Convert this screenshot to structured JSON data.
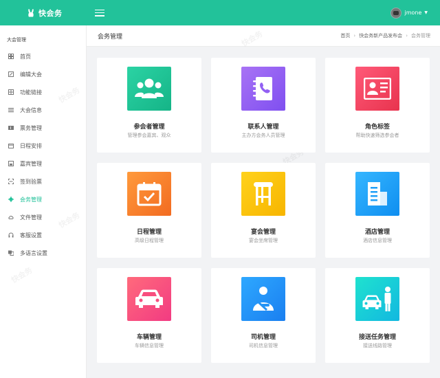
{
  "app": {
    "brand_name": "快会务"
  },
  "user": {
    "name": "jmone"
  },
  "sidebar": {
    "title": "大会管理",
    "items": [
      {
        "label": "首页",
        "icon": "home-icon"
      },
      {
        "label": "编辑大会",
        "icon": "edit-icon"
      },
      {
        "label": "功能链接",
        "icon": "link-icon"
      },
      {
        "label": "大会信息",
        "icon": "list-icon"
      },
      {
        "label": "票务管理",
        "icon": "ticket-icon"
      },
      {
        "label": "日程安排",
        "icon": "calendar-icon"
      },
      {
        "label": "嘉宾管理",
        "icon": "guest-icon"
      },
      {
        "label": "签到验票",
        "icon": "scan-icon"
      },
      {
        "label": "会务管理",
        "icon": "gear-icon",
        "active": true
      },
      {
        "label": "文件管理",
        "icon": "cloud-icon"
      },
      {
        "label": "客服设置",
        "icon": "headset-icon"
      },
      {
        "label": "多语言设置",
        "icon": "language-icon"
      }
    ]
  },
  "header": {
    "title": "会务管理",
    "breadcrumb": [
      "首页",
      "快会务新产品发布会",
      "会务管理"
    ]
  },
  "cards": [
    {
      "title": "参会者管理",
      "desc": "管理参会嘉宾、观众",
      "icon": "attendees-icon",
      "color": "#22c29a"
    },
    {
      "title": "联系人管理",
      "desc": "主办方会务人员管理",
      "icon": "contacts-book-icon",
      "color": "#9260f3"
    },
    {
      "title": "角色标签",
      "desc": "帮助快速筛选参会者",
      "icon": "role-card-icon",
      "color": "#f0405a"
    },
    {
      "title": "日程管理",
      "desc": "高级日程管理",
      "icon": "schedule-icon",
      "color": "#f77d2b"
    },
    {
      "title": "宴会管理",
      "desc": "宴会坐席管理",
      "icon": "stool-icon",
      "color": "#fbc30a"
    },
    {
      "title": "酒店管理",
      "desc": "酒店信息管理",
      "icon": "hotel-icon",
      "color": "#21a0f8"
    },
    {
      "title": "车辆管理",
      "desc": "车辆信息管理",
      "icon": "car-icon",
      "color": "#f84e7e"
    },
    {
      "title": "司机管理",
      "desc": "司机信息管理",
      "icon": "driver-icon",
      "color": "#2493f5"
    },
    {
      "title": "接送任务管理",
      "desc": "接送线路管理",
      "icon": "pickup-icon",
      "color": "#18cbd9"
    }
  ],
  "watermark_text": "快会务"
}
